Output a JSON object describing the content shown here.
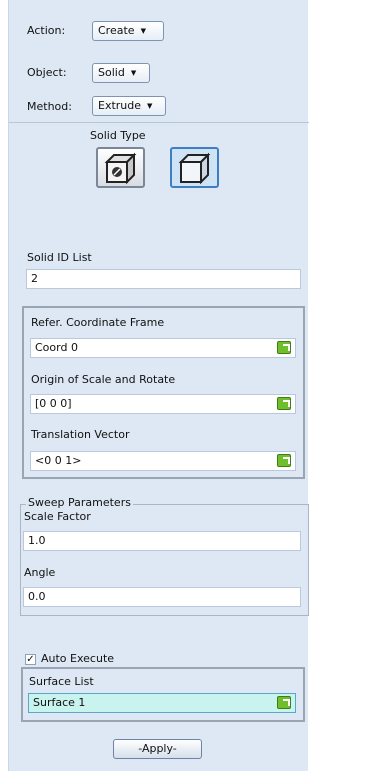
{
  "form": {
    "action": {
      "label": "Action:",
      "value": "Create"
    },
    "object": {
      "label": "Object:",
      "value": "Solid"
    },
    "method": {
      "label": "Method:",
      "value": "Extrude"
    },
    "dropdown_arrow": "▼"
  },
  "solid_type": {
    "label": "Solid Type",
    "buttons": [
      {
        "icon": "solid-with-hole-icon",
        "selected": false
      },
      {
        "icon": "solid-box-icon",
        "selected": true
      }
    ]
  },
  "solid_id": {
    "label": "Solid ID List",
    "value": "2"
  },
  "frame_group": {
    "coord_label": "Refer. Coordinate Frame",
    "coord_value": "Coord 0",
    "origin_label": "Origin of Scale and Rotate",
    "origin_value": "[0 0 0]",
    "translation_label": "Translation Vector",
    "translation_value": "<0 0 1>"
  },
  "sweep": {
    "legend": "Sweep Parameters",
    "scale_label": "Scale Factor",
    "scale_value": "1.0",
    "angle_label": "Angle",
    "angle_value": "0.0"
  },
  "auto_execute": {
    "label": "Auto Execute",
    "checked": true,
    "check_glyph": "✓"
  },
  "surface": {
    "label": "Surface List",
    "value": "Surface 1"
  },
  "apply_label": "-Apply-",
  "colors": {
    "panel_bg": "#dde8f4",
    "pick_icon": "#6fbe2c",
    "selected_border": "#3f7fbf"
  }
}
